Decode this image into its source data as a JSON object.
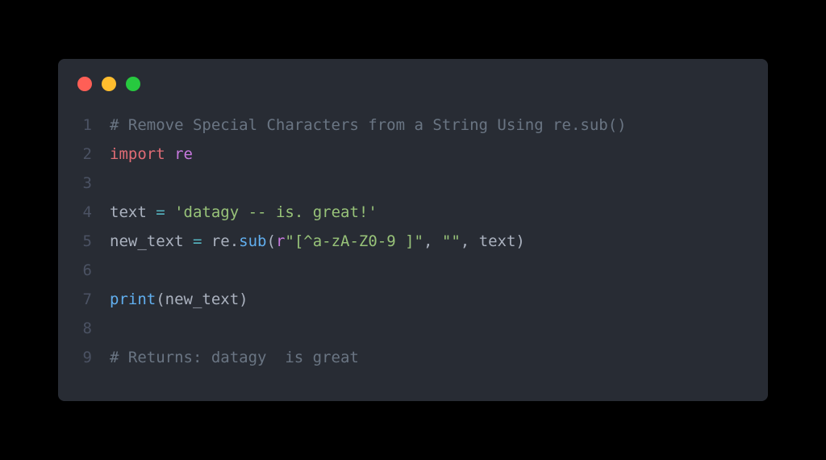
{
  "window": {
    "dots": [
      "red",
      "yellow",
      "green"
    ]
  },
  "code": {
    "lines": [
      {
        "n": "1",
        "tokens": [
          {
            "cls": "c-comment",
            "t": "# Remove Special Characters from a String Using re.sub()"
          }
        ]
      },
      {
        "n": "2",
        "tokens": [
          {
            "cls": "c-keyword",
            "t": "import"
          },
          {
            "cls": "c-default",
            "t": " "
          },
          {
            "cls": "c-ns",
            "t": "re"
          }
        ]
      },
      {
        "n": "3",
        "tokens": []
      },
      {
        "n": "4",
        "tokens": [
          {
            "cls": "c-default",
            "t": "text "
          },
          {
            "cls": "c-op",
            "t": "="
          },
          {
            "cls": "c-default",
            "t": " "
          },
          {
            "cls": "c-string",
            "t": "'datagy -- is. great!'"
          }
        ]
      },
      {
        "n": "5",
        "tokens": [
          {
            "cls": "c-default",
            "t": "new_text "
          },
          {
            "cls": "c-op",
            "t": "="
          },
          {
            "cls": "c-default",
            "t": " re."
          },
          {
            "cls": "c-func",
            "t": "sub"
          },
          {
            "cls": "c-default",
            "t": "("
          },
          {
            "cls": "c-prefix",
            "t": "r"
          },
          {
            "cls": "c-string",
            "t": "\"[^a-zA-Z0-9 ]\""
          },
          {
            "cls": "c-default",
            "t": ", "
          },
          {
            "cls": "c-string",
            "t": "\"\""
          },
          {
            "cls": "c-default",
            "t": ", text)"
          }
        ]
      },
      {
        "n": "6",
        "tokens": []
      },
      {
        "n": "7",
        "tokens": [
          {
            "cls": "c-builtin",
            "t": "print"
          },
          {
            "cls": "c-default",
            "t": "(new_text)"
          }
        ]
      },
      {
        "n": "8",
        "tokens": []
      },
      {
        "n": "9",
        "tokens": [
          {
            "cls": "c-comment",
            "t": "# Returns: datagy  is great"
          }
        ]
      }
    ]
  }
}
